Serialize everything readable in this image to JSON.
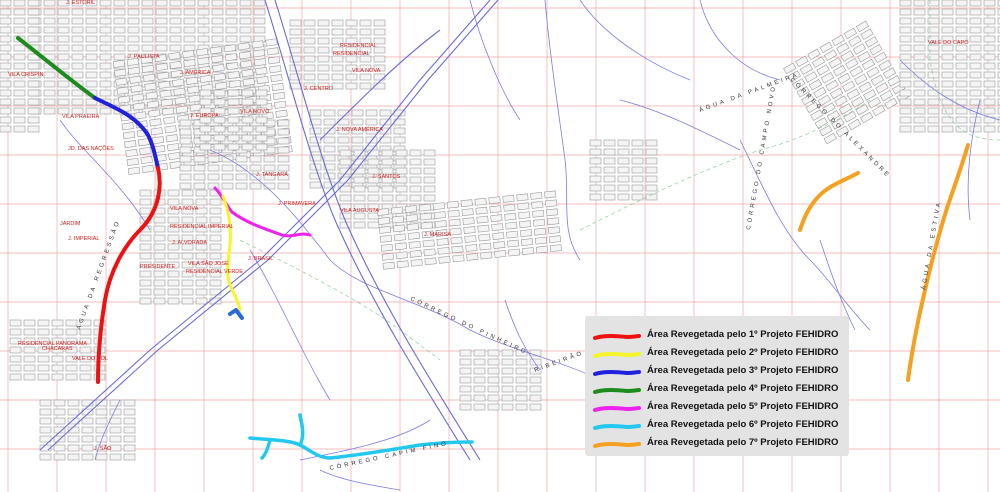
{
  "map": {
    "district_labels": [
      "J. ESTORIL",
      "VILA CRISPIN",
      "J. PAULISTA",
      "J. AMÉRICA",
      "J. EUROPA",
      "J. NOVA AMÉRICA",
      "RESIDENCIAL",
      "VILA NOVA",
      "J. CENTRO",
      "J. SANTOS",
      "VILA NOVO",
      "VILA AUGUSTA",
      "JD. DAS NAÇÕES",
      "VILA PRAEIRA",
      "J. TANGARÁ",
      "J. PRIMAVERA",
      "J. IMPERIAL",
      "VILA NOVA",
      "RESIDENCIAL IMPERIAL",
      "J. ALVORADA",
      "PRESIDENTE",
      "VILA SÃO JOSÉ",
      "RESIDENCIAL VERDE",
      "RESIDENCIAL",
      "J. MARISA",
      "RESIDENCIAL PANORAMA",
      "CHÁCARAS",
      "VALE DO SOL",
      "JARDIM",
      "J. SÃO",
      "VALE DO CAPO",
      "J. BRASIL"
    ],
    "stream_labels": [
      "CÓRREGO DO ALEXANDRE",
      "ÁGUA DA PALMEIRA",
      "ÁGUA DA ESTIVA",
      "CÓRREGO DO PINHEIRO",
      "CÓRREGO DO CAMPO NOVO",
      "ÁGUA DA REGRESSÃO",
      "CÓRREGO CAPIM FINO",
      "RIBEIRÃO"
    ]
  },
  "legend": {
    "items": [
      {
        "label": "Área Revegetada pelo 1º Projeto FEHIDRO",
        "color": "#ee1111"
      },
      {
        "label": "Área Revegetada pelo 2º Projeto FEHIDRO",
        "color": "#f5f52a"
      },
      {
        "label": "Área Revegetada pelo 3º Projeto FEHIDRO",
        "color": "#2020dd"
      },
      {
        "label": "Área Revegetada pelo 4º Projeto FEHIDRO",
        "color": "#1d8c1d"
      },
      {
        "label": "Área Revegetada pelo 5º Projeto FEHIDRO",
        "color": "#ee22ee"
      },
      {
        "label": "Área Revegetada pelo 6º Projeto FEHIDRO",
        "color": "#22c8ee"
      },
      {
        "label": "Área Revegetada pelo 7º Projeto FEHIDRO",
        "color": "#f5a020"
      }
    ]
  }
}
